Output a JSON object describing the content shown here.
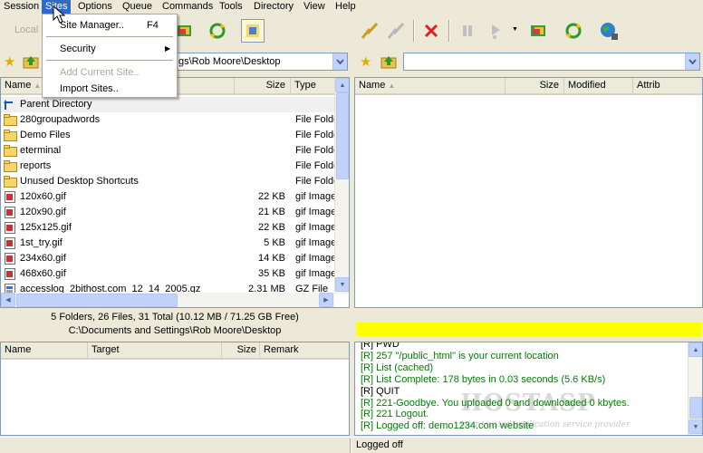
{
  "menubar": {
    "items": [
      "Session",
      "Sites",
      "Options",
      "Queue",
      "Commands",
      "Tools",
      "Directory",
      "View",
      "Help"
    ],
    "active": "Sites"
  },
  "sites_menu": {
    "site_manager": "Site Manager..",
    "site_manager_shortcut": "F4",
    "security": "Security",
    "add_current_site": "Add Current Site..",
    "import_sites": "Import Sites.."
  },
  "toolbar_left": {
    "local_label": "Local"
  },
  "local_address": {
    "value": "gs\\Rob Moore\\Desktop"
  },
  "remote_address": {
    "value": ""
  },
  "local_list": {
    "columns": [
      "Name",
      "Size",
      "Type"
    ],
    "rows": [
      {
        "name": "Parent Directory",
        "size": "",
        "type": "",
        "icon": "parent-dir-icon"
      },
      {
        "name": "280groupadwords",
        "size": "",
        "type": "File Folde",
        "icon": "folder-icon"
      },
      {
        "name": "Demo Files",
        "size": "",
        "type": "File Folde",
        "icon": "folder-icon"
      },
      {
        "name": "eterminal",
        "size": "",
        "type": "File Folde",
        "icon": "folder-icon"
      },
      {
        "name": "reports",
        "size": "",
        "type": "File Folde",
        "icon": "folder-icon"
      },
      {
        "name": "Unused Desktop Shortcuts",
        "size": "",
        "type": "File Folde",
        "icon": "folder-icon"
      },
      {
        "name": "120x60.gif",
        "size": "22 KB",
        "type": "gif Image",
        "icon": "gif-file-icon"
      },
      {
        "name": "120x90.gif",
        "size": "21 KB",
        "type": "gif Image",
        "icon": "gif-file-icon"
      },
      {
        "name": "125x125.gif",
        "size": "22 KB",
        "type": "gif Image",
        "icon": "gif-file-icon"
      },
      {
        "name": "1st_try.gif",
        "size": "5 KB",
        "type": "gif Image",
        "icon": "gif-file-icon"
      },
      {
        "name": "234x60.gif",
        "size": "14 KB",
        "type": "gif Image",
        "icon": "gif-file-icon"
      },
      {
        "name": "468x60.gif",
        "size": "35 KB",
        "type": "gif Image",
        "icon": "gif-file-icon"
      },
      {
        "name": "accesslog_2bithost.com_12_14_2005.gz",
        "size": "2.31 MB",
        "type": "GZ File",
        "icon": "gz-file-icon"
      }
    ]
  },
  "remote_list": {
    "columns": [
      "Name",
      "Size",
      "Modified",
      "Attrib"
    ]
  },
  "local_status": {
    "summary": "5 Folders, 26 Files, 31 Total (10.12 MB / 71.25 GB Free)",
    "path": "C:\\Documents and Settings\\Rob Moore\\Desktop"
  },
  "queue": {
    "columns": [
      "Name",
      "Target",
      "Size",
      "Remark"
    ]
  },
  "log": {
    "lines": [
      {
        "text": "[R] PWD",
        "color": "#000000"
      },
      {
        "text": "[R] 257 \"/public_html\" is your current location",
        "color": "#008000"
      },
      {
        "text": "[R] List (cached)",
        "color": "#008000"
      },
      {
        "text": "[R] List Complete: 178 bytes in 0.03 seconds (5.6 KB/s)",
        "color": "#008000"
      },
      {
        "text": "[R] QUIT",
        "color": "#000000"
      },
      {
        "text": "[R] 221-Goodbye. You uploaded 0 and downloaded 0 kbytes.",
        "color": "#008000"
      },
      {
        "text": "[R] 221 Logout.",
        "color": "#008000"
      },
      {
        "text": "[R] Logged off: demo1234.com website",
        "color": "#008000"
      }
    ]
  },
  "watermark": {
    "brand": "HOSTASP",
    "tagline": "your trusted application service provider"
  },
  "statusbar": {
    "remote_text": "Logged off"
  },
  "colors": {
    "progress": "#ffff00",
    "menu_highlight": "#316ac5",
    "log_green": "#008000"
  }
}
